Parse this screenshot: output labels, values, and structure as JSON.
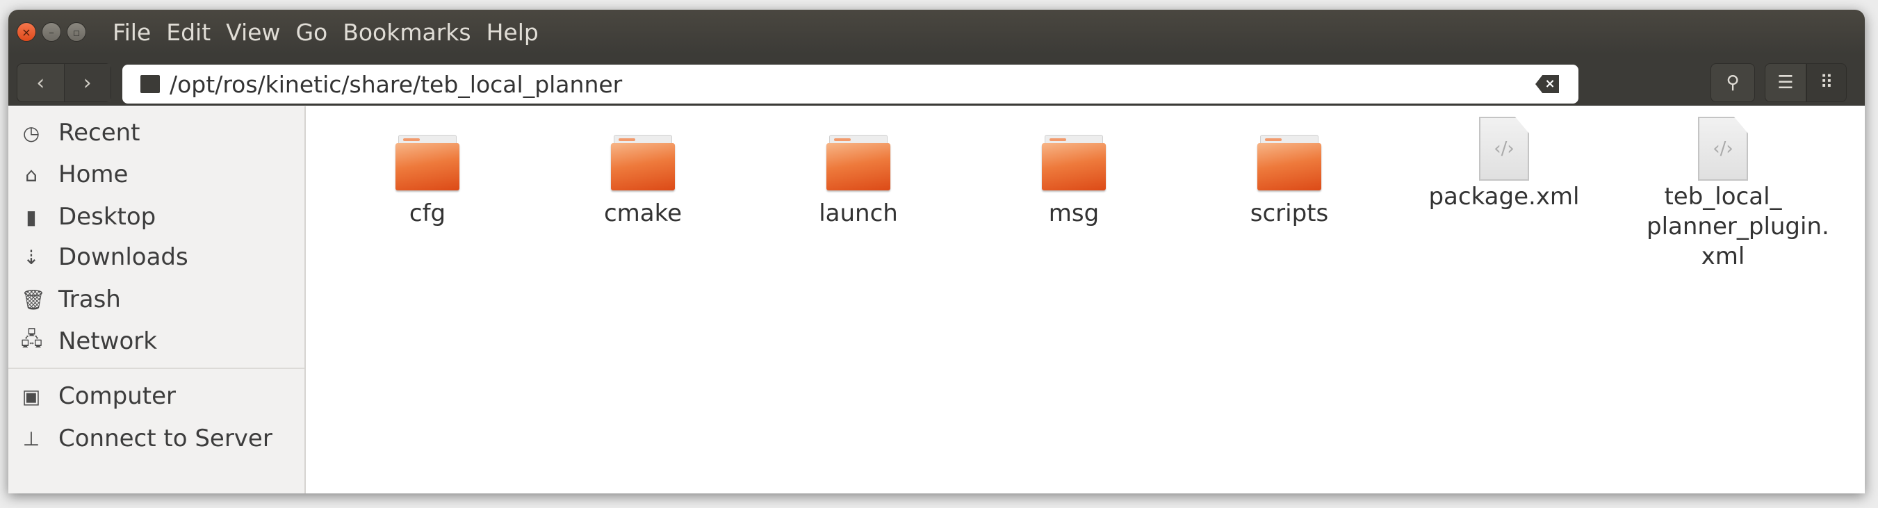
{
  "window": {
    "controls": {
      "close": "×",
      "minimize": "–",
      "maximize": "▫"
    }
  },
  "menu": [
    "File",
    "Edit",
    "View",
    "Go",
    "Bookmarks",
    "Help"
  ],
  "toolbar": {
    "back_icon": "chevron-left",
    "forward_icon": "chevron-right",
    "back": "‹",
    "forward": "›",
    "path": "/opt/ros/kinetic/share/teb_local_planner",
    "clear": "×",
    "search": "⚲",
    "list": "☰",
    "grid": "⠿"
  },
  "sidebar": {
    "items": [
      {
        "label": "Recent",
        "icon": "clock",
        "glyph": "◷"
      },
      {
        "label": "Home",
        "icon": "home",
        "glyph": "⌂"
      },
      {
        "label": "Desktop",
        "icon": "folder",
        "glyph": "▮"
      },
      {
        "label": "Downloads",
        "icon": "download",
        "glyph": "⇣"
      },
      {
        "label": "Trash",
        "icon": "trash",
        "glyph": "🗑"
      },
      {
        "label": "Network",
        "icon": "network",
        "glyph": "🖧"
      }
    ],
    "devices": [
      {
        "label": "Computer",
        "icon": "harddisk",
        "glyph": "▣"
      },
      {
        "label": "Connect to Server",
        "icon": "server",
        "glyph": "⊥"
      }
    ]
  },
  "files": [
    {
      "name": "cfg",
      "type": "folder"
    },
    {
      "name": "cmake",
      "type": "folder"
    },
    {
      "name": "launch",
      "type": "folder"
    },
    {
      "name": "msg",
      "type": "folder"
    },
    {
      "name": "scripts",
      "type": "folder"
    },
    {
      "name": "package.xml",
      "type": "xml",
      "glyph": "‹/›"
    },
    {
      "name": "teb_local_ planner_plugin. xml",
      "type": "xml",
      "glyph": "‹/›"
    }
  ]
}
